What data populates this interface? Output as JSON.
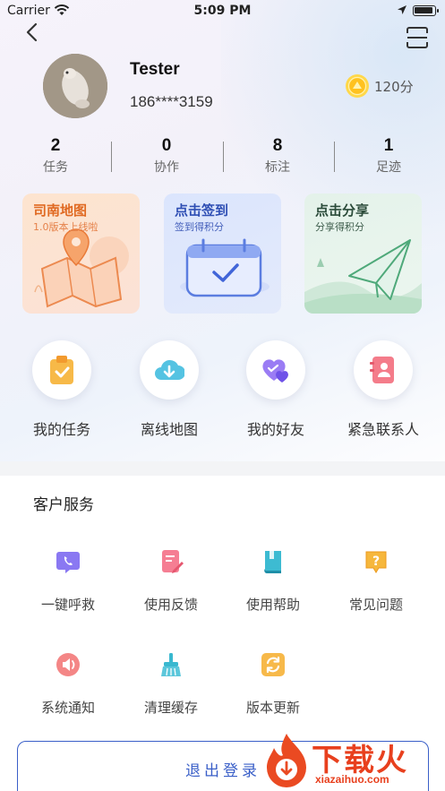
{
  "status_bar": {
    "carrier": "Carrier",
    "time": "5:09 PM"
  },
  "profile": {
    "name": "Tester",
    "phone": "186****3159",
    "points": "120分"
  },
  "stats": [
    {
      "value": "2",
      "label": "任务"
    },
    {
      "value": "0",
      "label": "协作"
    },
    {
      "value": "8",
      "label": "标注"
    },
    {
      "value": "1",
      "label": "足迹"
    }
  ],
  "promos": [
    {
      "title": "司南地图",
      "subtitle": "1.0版本上线啦"
    },
    {
      "title": "点击签到",
      "subtitle": "签到得积分"
    },
    {
      "title": "点击分享",
      "subtitle": "分享得积分"
    }
  ],
  "quick_actions": [
    {
      "label": "我的任务",
      "icon": "clipboard-icon",
      "color": "#f4a93a"
    },
    {
      "label": "离线地图",
      "icon": "cloud-download-icon",
      "color": "#3fb7d9"
    },
    {
      "label": "我的好友",
      "icon": "heart-icon",
      "color": "#8a6cf0"
    },
    {
      "label": "紧急联系人",
      "icon": "contact-book-icon",
      "color": "#f06a7c"
    }
  ],
  "customer_service": {
    "title": "客户服务",
    "items": [
      {
        "label": "一键呼救",
        "icon": "phone-icon",
        "color": "#7b6bf0"
      },
      {
        "label": "使用反馈",
        "icon": "feedback-icon",
        "color": "#f0708a"
      },
      {
        "label": "使用帮助",
        "icon": "book-icon",
        "color": "#35b6cc"
      },
      {
        "label": "常见问题",
        "icon": "question-icon",
        "color": "#f4a93a"
      },
      {
        "label": "系统通知",
        "icon": "speaker-icon",
        "color": "#f07070"
      },
      {
        "label": "清理缓存",
        "icon": "broom-icon",
        "color": "#35b6cc"
      },
      {
        "label": "版本更新",
        "icon": "refresh-icon",
        "color": "#f4a93a"
      }
    ]
  },
  "logout_label": "退出登录",
  "watermark": {
    "text": "下载火",
    "url": "xiazaihuo.com"
  }
}
